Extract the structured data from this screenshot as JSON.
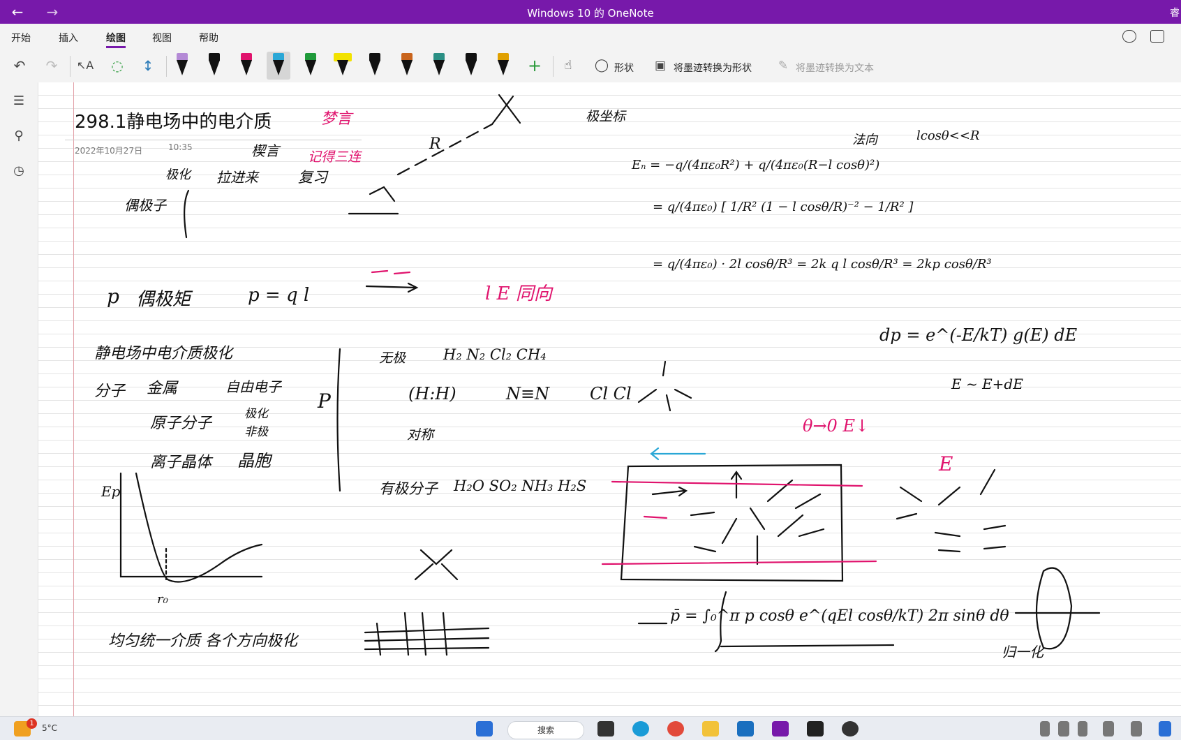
{
  "window": {
    "title": "Windows 10 的 OneNote",
    "corner_text": "睿"
  },
  "menu": {
    "tabs": [
      "开始",
      "插入",
      "绘图",
      "视图",
      "帮助"
    ],
    "active": "绘图"
  },
  "toolbar": {
    "shapes_label": "形状",
    "ink_to_shape_label": "将墨迹转换为形状",
    "ink_to_text_label": "将墨迹转换为文本",
    "pens": [
      "#b48ad6",
      "#111111",
      "#e0136d",
      "#2aa7d6",
      "#1f9a3a",
      "#f2e200",
      "#111111",
      "#c9641c",
      "#2a8f84",
      "#111111",
      "#e0a000"
    ],
    "selected_pen_index": 3
  },
  "note": {
    "title": "298.1静电场中的电介质",
    "date": "2022年10月27日",
    "time": "10:35"
  },
  "ink": {
    "prelude": "梦言",
    "preface": "楔言",
    "remember": "记得三连",
    "polarize": "极化",
    "pull_in": "拉进来",
    "review": "复习",
    "dipole": "偶极子",
    "dipole_moment_label": "偶极矩",
    "dipole_moment_eq": "p = q l",
    "polar_coords": "极坐标",
    "normal_dir": "法向",
    "approx": "lcosθ<<R",
    "section": "静电场中电介质极化",
    "molecule": "分子",
    "metal": "金属",
    "free_electron": "自由电子",
    "atom_molecule": "原子分子",
    "polar": "极化",
    "nonpolar": "非极",
    "ionic_crystal": "离子晶体",
    "unit_cell": "晶胞",
    "isotropic": "均匀统一介质 各个方向极化",
    "nonpolar_molecule": "无极",
    "nonpolar_list": "H₂ N₂ Cl₂ CH₄",
    "symmetric": "对称",
    "polar_molecule": "有极分子",
    "polar_list": "H₂O SO₂ NH₃ H₂S",
    "E_label": "E",
    "theta_rule": "θ→0  E↓",
    "l_E_same": "l E 同向",
    "dp_eq": "dp = e^(-E/kT) g(E) dE",
    "E_range": "E ~ E+dE",
    "normalize": "归一化",
    "En_eq": "Eₙ = −q/(4πε₀R²) + q/(4πε₀(R−l cosθ)²)",
    "step2": "= q/(4πε₀) [ 1/R² (1 − l cosθ/R)⁻² − 1/R² ]",
    "step3": "= q/(4πε₀) · 2l cosθ/R³ = 2k q l cosθ/R³ = 2kp cosθ/R³",
    "avg_eq": "p̄ = ∫₀^π p cosθ e^(qEl cosθ/kT) 2π sinθ dθ"
  },
  "taskbar": {
    "weather": "5°C",
    "notification_count": "1",
    "search": "搜索"
  }
}
